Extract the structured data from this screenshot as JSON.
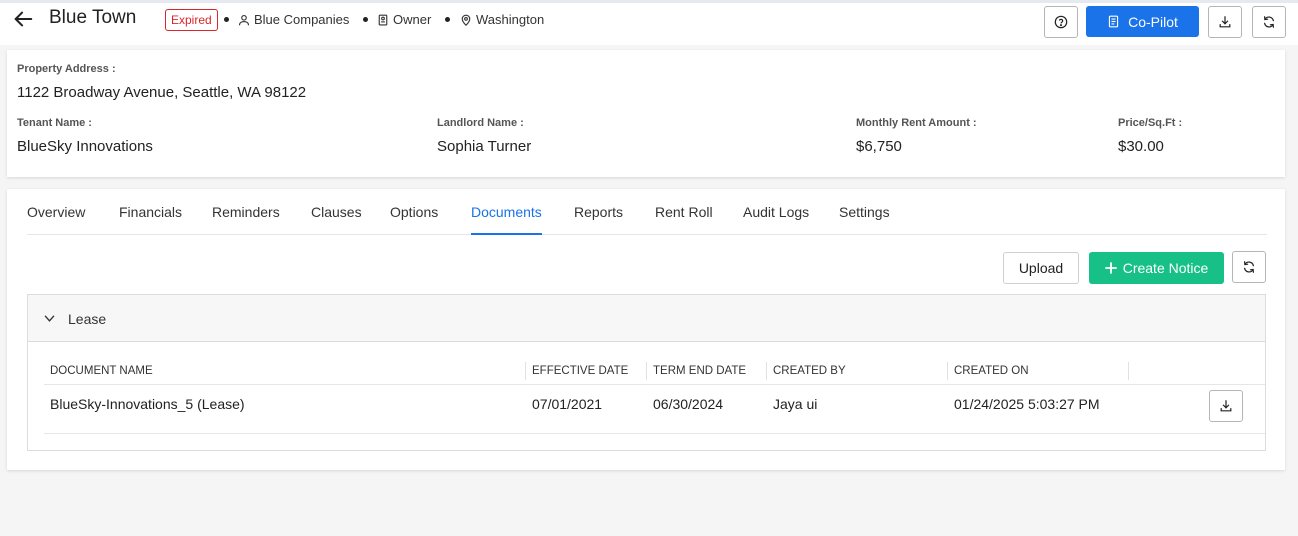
{
  "header": {
    "title": "Blue Town",
    "status": "Expired",
    "company": "Blue Companies",
    "role": "Owner",
    "location": "Washington",
    "copilot_label": "Co-Pilot"
  },
  "property": {
    "address_label": "Property Address :",
    "address": "1122 Broadway Avenue, Seattle, WA 98122",
    "tenant_label": "Tenant Name :",
    "tenant": "BlueSky Innovations",
    "landlord_label": "Landlord Name :",
    "landlord": "Sophia Turner",
    "rent_label": "Monthly Rent Amount :",
    "rent": "$6,750",
    "price_label": "Price/Sq.Ft :",
    "price": "$30.00"
  },
  "tabs": [
    "Overview",
    "Financials",
    "Reminders",
    "Clauses",
    "Options",
    "Documents",
    "Reports",
    "Rent Roll",
    "Audit Logs",
    "Settings"
  ],
  "active_tab": "Documents",
  "actions": {
    "upload_label": "Upload",
    "create_notice_label": "Create Notice"
  },
  "lease_section": {
    "title": "Lease",
    "columns": [
      "DOCUMENT NAME",
      "EFFECTIVE DATE",
      "TERM END DATE",
      "CREATED BY",
      "CREATED ON"
    ],
    "rows": [
      [
        "BlueSky-Innovations_5 (Lease)",
        "07/01/2021",
        "06/30/2024",
        "Jaya ui",
        "01/24/2025 5:03:27 PM"
      ]
    ]
  },
  "colors": {
    "primary": "#1a73e8",
    "success": "#16c086",
    "expired": "#d9262c"
  }
}
